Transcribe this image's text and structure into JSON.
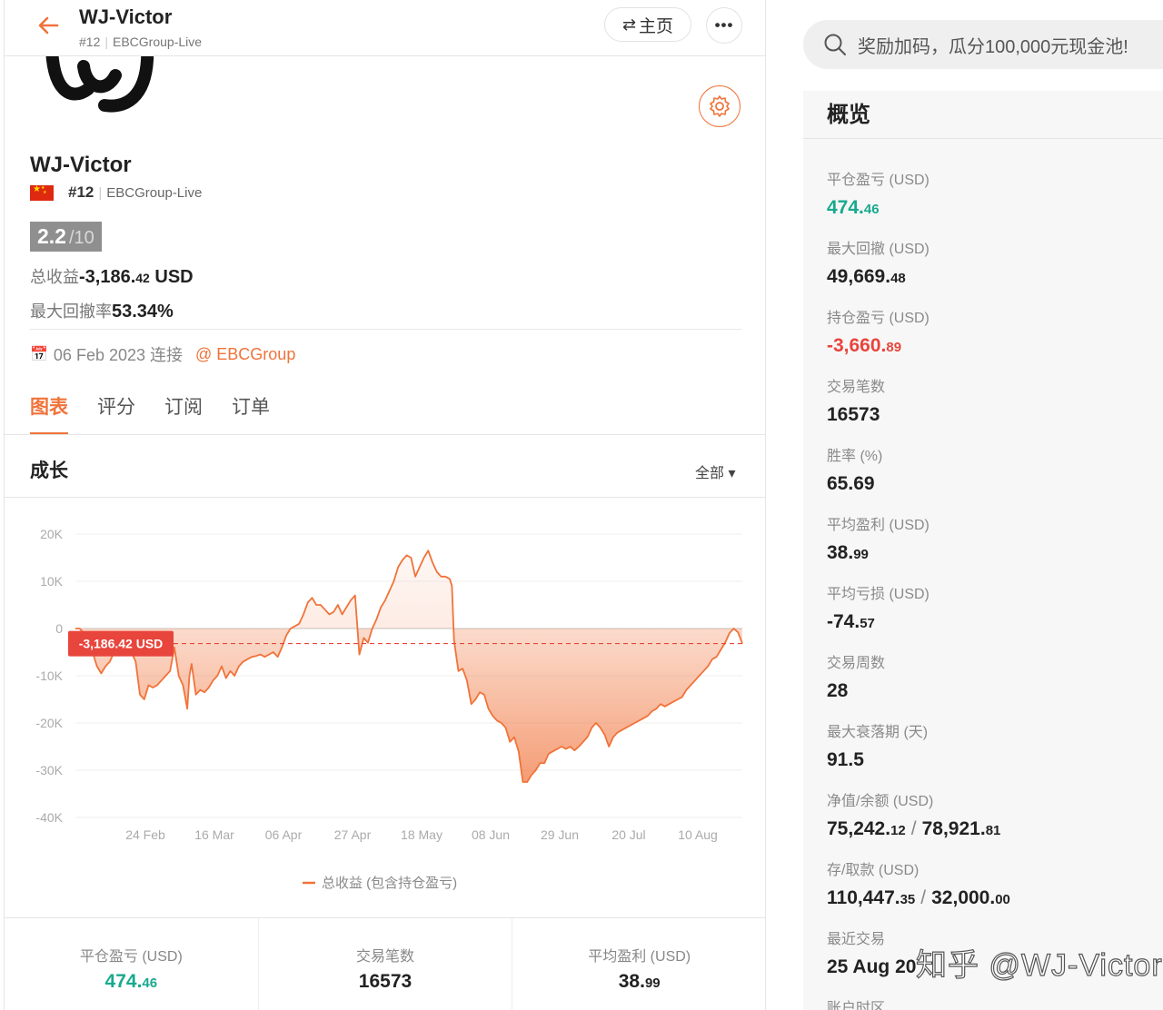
{
  "header": {
    "name": "WJ-Victor",
    "rank": "#12",
    "broker": "EBCGroup-Live",
    "home_label": "主页",
    "more_label": "•••"
  },
  "profile": {
    "name": "WJ-Victor",
    "rank": "#12",
    "broker": "EBCGroup-Live",
    "score": "2.2",
    "score_denom": "/10",
    "total_label": "总收益",
    "total_value_main": "-3,186.",
    "total_value_small": "42",
    "total_value_unit": " USD",
    "drawdown_label": "最大回撤率",
    "drawdown_value": "53.34%",
    "connected_date": "06 Feb 2023 连接",
    "connected_link": "@ EBCGroup"
  },
  "tabs": [
    "图表",
    "评分",
    "订阅",
    "订单"
  ],
  "section": {
    "title": "成长",
    "range": "全部"
  },
  "chart_data": {
    "type": "area",
    "ylim": [
      -40000,
      20000
    ],
    "yticks": [
      "20K",
      "10K",
      "0",
      "-10K",
      "-20K",
      "-30K",
      "-40K"
    ],
    "xticks": [
      "24 Feb",
      "16 Mar",
      "06 Apr",
      "27 Apr",
      "18 May",
      "08 Jun",
      "29 Jun",
      "20 Jul",
      "10 Aug"
    ],
    "legend": "总收益 (包含持仓盈亏)",
    "current_label": "-3,186.42 USD",
    "current_value": -3186.42,
    "color": "#f0733a",
    "series": [
      {
        "name": "总收益 (包含持仓盈亏)",
        "points": [
          [
            0,
            0
          ],
          [
            2,
            0
          ],
          [
            4,
            -1000
          ],
          [
            6,
            -2000
          ],
          [
            8,
            -5000
          ],
          [
            10,
            -8000
          ],
          [
            12,
            -9500
          ],
          [
            14,
            -8000
          ],
          [
            16,
            -7000
          ],
          [
            18,
            -5000
          ],
          [
            20,
            -3000
          ],
          [
            22,
            -2500
          ],
          [
            24,
            -3000
          ],
          [
            26,
            -5000
          ],
          [
            28,
            -7000
          ],
          [
            30,
            -14000
          ],
          [
            32,
            -15000
          ],
          [
            34,
            -12000
          ],
          [
            36,
            -12500
          ],
          [
            38,
            -12000
          ],
          [
            40,
            -11000
          ],
          [
            42,
            -10000
          ],
          [
            44,
            -9000
          ],
          [
            46,
            -4000
          ],
          [
            48,
            -10000
          ],
          [
            50,
            -12000
          ],
          [
            52,
            -17000
          ],
          [
            53,
            -10000
          ],
          [
            54,
            -7500
          ],
          [
            56,
            -14000
          ],
          [
            58,
            -13000
          ],
          [
            60,
            -13500
          ],
          [
            62,
            -12500
          ],
          [
            64,
            -11000
          ],
          [
            66,
            -10000
          ],
          [
            68,
            -8000
          ],
          [
            70,
            -10500
          ],
          [
            72,
            -9000
          ],
          [
            74,
            -10000
          ],
          [
            76,
            -8000
          ],
          [
            78,
            -7000
          ],
          [
            80,
            -6500
          ],
          [
            82,
            -6000
          ],
          [
            84,
            -5800
          ],
          [
            86,
            -5500
          ],
          [
            88,
            -6000
          ],
          [
            90,
            -5500
          ],
          [
            92,
            -5000
          ],
          [
            94,
            -6000
          ],
          [
            96,
            -4000
          ],
          [
            98,
            -1500
          ],
          [
            100,
            0
          ],
          [
            102,
            500
          ],
          [
            104,
            1000
          ],
          [
            106,
            3000
          ],
          [
            108,
            5500
          ],
          [
            110,
            6500
          ],
          [
            112,
            5000
          ],
          [
            114,
            5000
          ],
          [
            116,
            4000
          ],
          [
            118,
            3000
          ],
          [
            120,
            3500
          ],
          [
            122,
            5000
          ],
          [
            124,
            3000
          ],
          [
            126,
            4500
          ],
          [
            128,
            6000
          ],
          [
            130,
            7000
          ],
          [
            132,
            -5500
          ],
          [
            134,
            -2000
          ],
          [
            136,
            -3000
          ],
          [
            138,
            0
          ],
          [
            140,
            2000
          ],
          [
            142,
            4500
          ],
          [
            144,
            6000
          ],
          [
            146,
            8000
          ],
          [
            148,
            10000
          ],
          [
            150,
            13000
          ],
          [
            152,
            14500
          ],
          [
            154,
            15500
          ],
          [
            156,
            15000
          ],
          [
            158,
            11000
          ],
          [
            160,
            13000
          ],
          [
            162,
            15000
          ],
          [
            164,
            16500
          ],
          [
            166,
            14000
          ],
          [
            168,
            12000
          ],
          [
            170,
            11000
          ],
          [
            172,
            11000
          ],
          [
            174,
            10500
          ],
          [
            175,
            9000
          ],
          [
            176,
            -2500
          ],
          [
            178,
            -9000
          ],
          [
            180,
            -8500
          ],
          [
            182,
            -11000
          ],
          [
            184,
            -16000
          ],
          [
            186,
            -15000
          ],
          [
            188,
            -13500
          ],
          [
            190,
            -14000
          ],
          [
            192,
            -17000
          ],
          [
            194,
            -18500
          ],
          [
            196,
            -19500
          ],
          [
            198,
            -20000
          ],
          [
            200,
            -21000
          ],
          [
            202,
            -24000
          ],
          [
            204,
            -23000
          ],
          [
            206,
            -26000
          ],
          [
            208,
            -32500
          ],
          [
            210,
            -32500
          ],
          [
            212,
            -31000
          ],
          [
            214,
            -30000
          ],
          [
            216,
            -28500
          ],
          [
            218,
            -28500
          ],
          [
            220,
            -26500
          ],
          [
            222,
            -26000
          ],
          [
            224,
            -25500
          ],
          [
            226,
            -25000
          ],
          [
            228,
            -25500
          ],
          [
            230,
            -25000
          ],
          [
            232,
            -25800
          ],
          [
            234,
            -25000
          ],
          [
            236,
            -24000
          ],
          [
            238,
            -23000
          ],
          [
            240,
            -21000
          ],
          [
            242,
            -20000
          ],
          [
            244,
            -21000
          ],
          [
            246,
            -22500
          ],
          [
            248,
            -25000
          ],
          [
            250,
            -23000
          ],
          [
            252,
            -22000
          ],
          [
            254,
            -21500
          ],
          [
            256,
            -21000
          ],
          [
            258,
            -20500
          ],
          [
            260,
            -20000
          ],
          [
            262,
            -19500
          ],
          [
            264,
            -19000
          ],
          [
            266,
            -18500
          ],
          [
            268,
            -17500
          ],
          [
            270,
            -17000
          ],
          [
            272,
            -16000
          ],
          [
            274,
            -16500
          ],
          [
            276,
            -16000
          ],
          [
            278,
            -15500
          ],
          [
            280,
            -15000
          ],
          [
            282,
            -14500
          ],
          [
            284,
            -13000
          ],
          [
            286,
            -12000
          ],
          [
            288,
            -11000
          ],
          [
            290,
            -10000
          ],
          [
            292,
            -9000
          ],
          [
            294,
            -8000
          ],
          [
            296,
            -6500
          ],
          [
            298,
            -6000
          ],
          [
            300,
            -4500
          ],
          [
            302,
            -3000
          ],
          [
            304,
            -1000
          ],
          [
            306,
            0
          ],
          [
            308,
            -800
          ],
          [
            310,
            -3186.42
          ]
        ]
      }
    ]
  },
  "summary": [
    {
      "label": "平仓盈亏 (USD)",
      "main": "474.",
      "small": "46",
      "tone": "green"
    },
    {
      "label": "交易笔数",
      "main": "16573",
      "small": "",
      "tone": ""
    },
    {
      "label": "平均盈利 (USD)",
      "main": "38.",
      "small": "99",
      "tone": ""
    }
  ],
  "search": {
    "placeholder": "奖励加码，瓜分100,000元现金池!"
  },
  "overview": {
    "title": "概览",
    "items": [
      {
        "label": "平仓盈亏 (USD)",
        "main": "474.",
        "small": "46",
        "tone": "green"
      },
      {
        "label": "最大回撤 (USD)",
        "main": "49,669.",
        "small": "48",
        "tone": ""
      },
      {
        "label": "持仓盈亏 (USD)",
        "main": "-3,660.",
        "small": "89",
        "tone": "red"
      },
      {
        "label": "交易笔数",
        "main": "16573",
        "small": "",
        "tone": ""
      },
      {
        "label": "胜率 (%)",
        "main": "65.69",
        "small": "",
        "tone": ""
      },
      {
        "label": "平均盈利 (USD)",
        "main": "38.",
        "small": "99",
        "tone": ""
      },
      {
        "label": "平均亏损 (USD)",
        "main": "-74.",
        "small": "57",
        "tone": ""
      },
      {
        "label": "交易周数",
        "main": "28",
        "small": "",
        "tone": ""
      },
      {
        "label": "最大衰落期 (天)",
        "main": "91.5",
        "small": "",
        "tone": ""
      },
      {
        "label": "净值/余额 (USD)",
        "main": "75,242.",
        "small": "12",
        "main2": "78,921.",
        "small2": "81",
        "tone": ""
      },
      {
        "label": "存/取款 (USD)",
        "main": "110,447.",
        "small": "35",
        "main2": "32,000.",
        "small2": "00",
        "tone": ""
      },
      {
        "label": "最近交易",
        "main": "25 Aug 20",
        "small": "",
        "tone": ""
      },
      {
        "label": "账户时区",
        "main": "",
        "small": "",
        "tone": ""
      }
    ]
  },
  "watermark": "知乎 @WJ-Victor"
}
